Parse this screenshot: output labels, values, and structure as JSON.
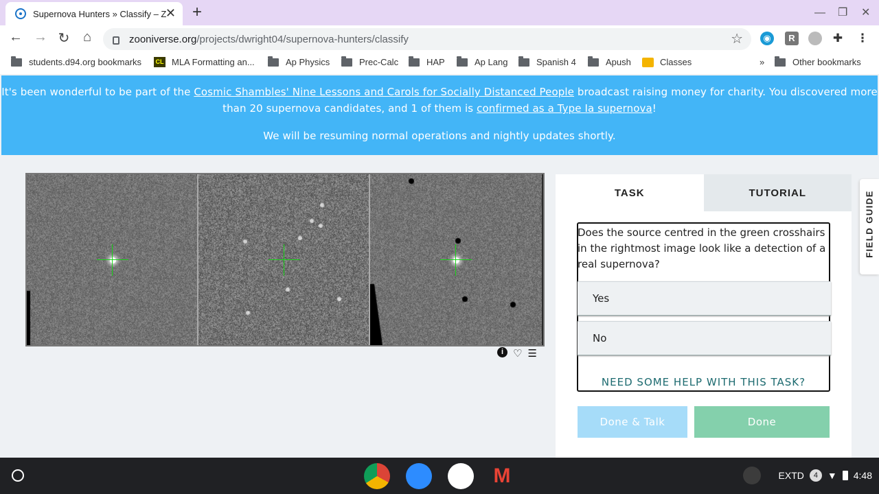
{
  "browser": {
    "tab_title": "Supernova Hunters » Classify – Z",
    "new_tab": "+",
    "url_host": "zooniverse.org",
    "url_path": "/projects/dwright04/supernova-hunters/classify",
    "ext_r": "R"
  },
  "bookmarks": [
    {
      "label": "students.d94.org bookmarks",
      "icon": "folder-icon"
    },
    {
      "label": "MLA Formatting an...",
      "icon": "mla-icon"
    },
    {
      "label": "Ap Physics",
      "icon": "folder-icon"
    },
    {
      "label": "Prec-Calc",
      "icon": "folder-icon"
    },
    {
      "label": "HAP",
      "icon": "folder-icon"
    },
    {
      "label": "Ap Lang",
      "icon": "folder-icon"
    },
    {
      "label": "Spanish 4",
      "icon": "folder-icon"
    },
    {
      "label": "Apush",
      "icon": "folder-icon"
    },
    {
      "label": "Classes",
      "icon": "classroom-icon"
    }
  ],
  "bookmarks_overflow": "»",
  "other_bookmarks": "Other bookmarks",
  "banner": {
    "text1": "It's been wonderful to be part of the ",
    "link1": "Cosmic Shambles' Nine Lessons and Carols for Socially Distanced People",
    "text2": " broadcast raising money for charity. You discovered more than 20 supernova candidates, and 1 of them is ",
    "link2": "confirmed as a Type Ia supernova",
    "text3": "!",
    "line2": "We will be resuming normal operations and nightly updates shortly."
  },
  "panel": {
    "tab_task": "TASK",
    "tab_tutorial": "TUTORIAL",
    "question": "Does the source centred in the green crosshairs in the rightmost image look like a detection of a real supernova?",
    "answers": [
      "Yes",
      "No"
    ],
    "help": "NEED SOME HELP WITH THIS TASK?",
    "done_talk": "Done & Talk",
    "done": "Done"
  },
  "field_guide": "FIELD GUIDE",
  "shelf": {
    "extd": "EXTD",
    "notif_count": "4",
    "time": "4:48"
  },
  "colors": {
    "banner": "#43b5f7",
    "done_talk": "#a6dcf9",
    "done": "#84d0ac",
    "help_text": "#1c6a6f"
  }
}
